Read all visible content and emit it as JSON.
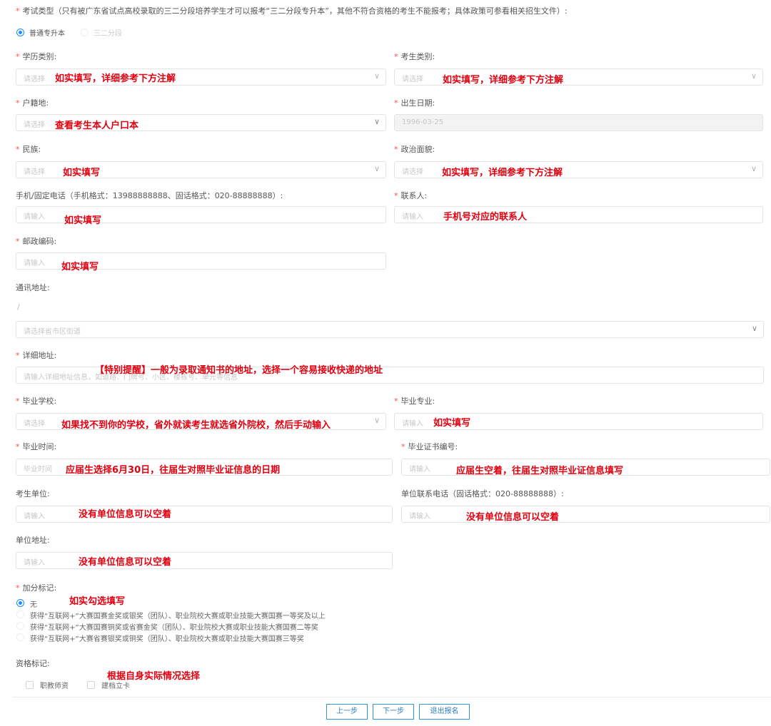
{
  "exam_type": {
    "label": "考试类型（只有被广东省试点高校录取的三二分段培养学生才可以报考“三二分段专升本”，其他不符合资格的考生不能报考；具体政策可参看相关招生文件）:",
    "options": [
      "普通专升本",
      "三二分段"
    ],
    "selected": "普通专升本"
  },
  "fields": {
    "education_type": {
      "label": "学历类别:",
      "placeholder": "请选择",
      "note": "如实填写，详细参考下方注解"
    },
    "candidate_type": {
      "label": "考生类别:",
      "placeholder": "请选择",
      "note": "如实填写，详细参考下方注解"
    },
    "household": {
      "label": "户籍地:",
      "placeholder": "请选择",
      "note": "查看考生本人户口本"
    },
    "birth_date": {
      "label": "出生日期:",
      "value": "1996-03-25"
    },
    "ethnicity": {
      "label": "民族:",
      "placeholder": "请选择",
      "note": "如实填写"
    },
    "political_status": {
      "label": "政治面貌:",
      "placeholder": "请选择",
      "note": "如实填写，详细参考下方注解"
    },
    "phone": {
      "label": "手机/固定电话（手机格式：13988888888、固话格式：020-88888888）:",
      "placeholder": "请输入",
      "note": "如实填写"
    },
    "contact": {
      "label": "联系人:",
      "placeholder": "请输入",
      "note": "手机号对应的联系人"
    },
    "postcode": {
      "label": "邮政编码:",
      "placeholder": "请输入",
      "note": "如实填写"
    },
    "mailing_address": {
      "label": "通讯地址:",
      "separator": "/",
      "placeholder": "请选择省市区街道"
    },
    "detail_address": {
      "label": "详细地址:",
      "placeholder": "请输入详细地址信息，如道路、门牌号、小区、楼栋号、单元等信息",
      "note": "【特别提醒】一般为录取通知书的地址，选择一个容易接收快递的地址"
    },
    "school": {
      "label": "毕业学校:",
      "placeholder": "请选择",
      "note": "如果找不到你的学校，省外就读考生就选省外院校，然后手动输入"
    },
    "major": {
      "label": "毕业专业:",
      "placeholder": "请输入",
      "note": "如实填写"
    },
    "grad_time": {
      "label": "毕业时间:",
      "placeholder": "毕业时间",
      "note": "应届生选择6月30日，往届生对照毕业证信息的日期"
    },
    "cert_no": {
      "label": "毕业证书编号:",
      "placeholder": "请输入",
      "note": "应届生空着，往届生对照毕业证信息填写"
    },
    "employer": {
      "label": "考生单位:",
      "placeholder": "请输入",
      "note": "没有单位信息可以空着"
    },
    "employer_phone": {
      "label": "单位联系电话（固话格式：020-88888888）:",
      "placeholder": "请输入",
      "note": "没有单位信息可以空着"
    },
    "employer_address": {
      "label": "单位地址:",
      "placeholder": "请输入",
      "note": "没有单位信息可以空着"
    }
  },
  "bonus": {
    "label": "加分标记:",
    "note": "如实勾选填写",
    "options": [
      "无",
      "获得“互联网+”大赛国赛金奖或银奖（团队）、职业院校大赛或职业技能大赛国赛一等奖及以上",
      "获得“互联网+”大赛国赛铜奖或省赛金奖（团队）、职业院校大赛或职业技能大赛国赛二等奖",
      "获得“互联网+”大赛省赛银奖或铜奖（团队）、职业院校大赛或职业技能大赛国赛三等奖"
    ],
    "selected": "无"
  },
  "qualification": {
    "label": "资格标记:",
    "note": "根据自身实际情况选择",
    "options": [
      "职教师资",
      "建档立卡"
    ]
  },
  "buttons": {
    "prev": "上一步",
    "next": "下一步",
    "exit": "退出报名"
  },
  "colors": {
    "accent": "#1890ff",
    "required": "#ff4d4f",
    "annotation": "#e0000f",
    "button_border": "#2e98d6"
  }
}
